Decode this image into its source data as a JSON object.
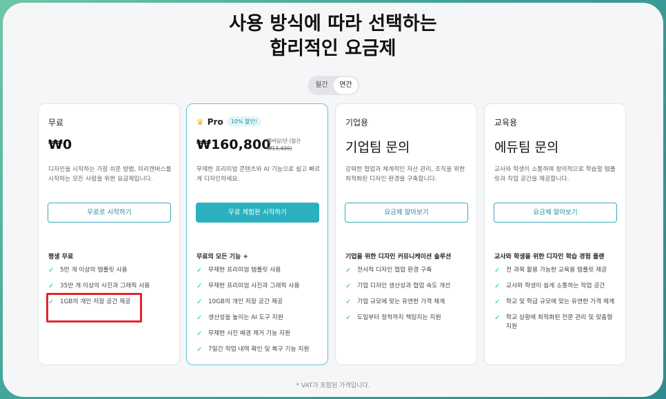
{
  "headline": {
    "line1": "사용 방식에 따라 선택하는",
    "line2": "합리적인 요금제"
  },
  "billing_toggle": {
    "monthly": "월간",
    "yearly": "연간",
    "selected": "연간"
  },
  "plans": [
    {
      "title": "무료",
      "price": "₩0",
      "description": "디자인을 시작하는 가장 쉬운 방법, 미리캔버스를 시작하는 모든 사람을 위한 요금제입니다.",
      "button": "무료로 시작하기",
      "features_title": "평생 무료",
      "features": [
        "5만 개 이상의 템플릿 사용",
        "35만 개 이상의 사진과 그래픽 사용",
        "1GB의 개인 저장 공간 제공"
      ]
    },
    {
      "title": "Pro",
      "badge": "10% 할인!",
      "price": "₩160,800",
      "price_note": "멤버당/년 (월간",
      "price_original": "₩13,400)",
      "description": "무제한 프리미엄 콘텐츠와 AI 기능으로 쉽고 빠르게 디자인하세요.",
      "button": "무료 체험판 시작하기",
      "features_title": "무료의 모든 기능 +",
      "features": [
        "무제한 프리미엄 템플릿 사용",
        "무제한 프리미엄 사진과 그래픽 사용",
        "10GB의 개인 저장 공간 제공",
        "생산성을 높이는 AI 도구 지원",
        "무제한 사진 배경 제거 기능 지원",
        "7일간 작업 내역 확인 및 복구 기능 지원"
      ]
    },
    {
      "title": "기업용",
      "price": "기업팀 문의",
      "description": "강력한 협업과 체계적인 자산 관리, 조직을 위한 최적화된 디자인 환경을 구축합니다.",
      "button": "요금제 알아보기",
      "features_title": "기업을 위한 디자인 커뮤니케이션 솔루션",
      "features": [
        "전사적 디자인 협업 환경 구축",
        "기업 디자인 생산성과 협업 속도 개선",
        "기업 규모에 맞는 유연한 가격 체계",
        "도입부터 정착까지 책임지는 지원"
      ]
    },
    {
      "title": "교육용",
      "price": "에듀팀 문의",
      "description": "교사와 학생이 소통하며 창의적으로 학습할 템플릿과 작업 공간을 제공합니다.",
      "button": "요금제 알아보기",
      "features_title": "교사와 학생을 위한 디자인 학습 경험 플랜",
      "features": [
        "전 과목 활용 가능한 교육용 템플릿 제공",
        "교사와 학생이 쉽게 소통하는 작업 공간",
        "학교 및 학급 규모에 맞는 유연한 가격 체계",
        "학교 상황에 최적화된 전문 관리 및 맞춤형 지원"
      ]
    }
  ],
  "footer_note": "* VAT가 포함된 가격입니다.",
  "colors": {
    "accent": "#2bb0bf",
    "highlight": "#e4232c"
  }
}
